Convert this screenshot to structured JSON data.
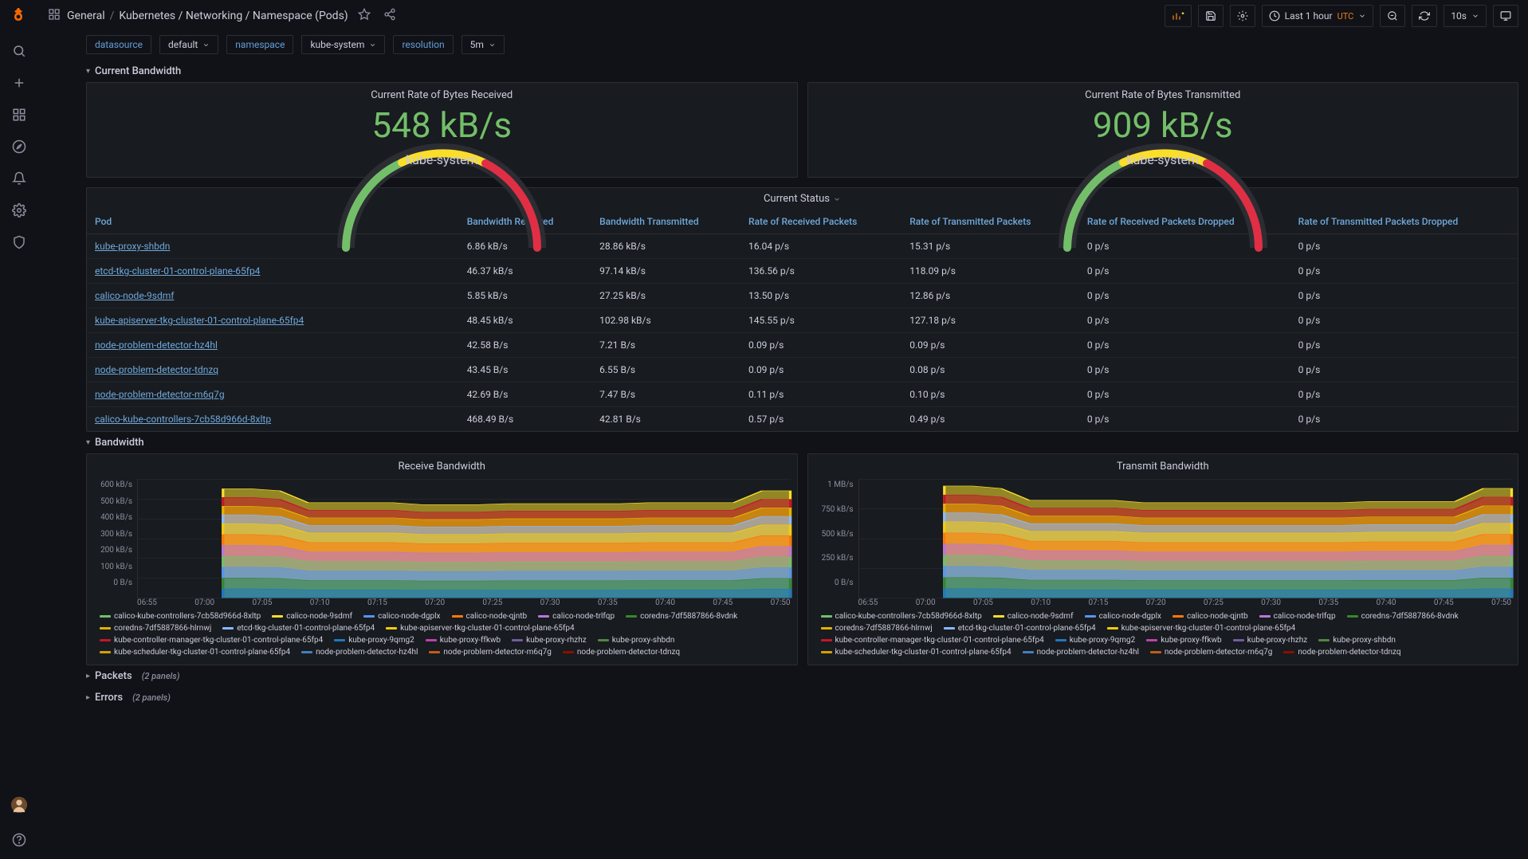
{
  "breadcrumb": {
    "root": "General",
    "path": "Kubernetes / Networking / Namespace (Pods)"
  },
  "timeRange": {
    "label": "Last 1 hour",
    "tz": "UTC",
    "refresh": "10s"
  },
  "filters": {
    "datasource_label": "datasource",
    "datasource_value": "default",
    "namespace_label": "namespace",
    "namespace_value": "kube-system",
    "resolution_label": "resolution",
    "resolution_value": "5m"
  },
  "rows": {
    "currentBandwidth": "Current Bandwidth",
    "bandwidth": "Bandwidth",
    "packets": "Packets",
    "packets_count": "(2 panels)",
    "errors": "Errors",
    "errors_count": "(2 panels)"
  },
  "gauges": {
    "rx": {
      "title": "Current Rate of Bytes Received",
      "value": "548 kB/s",
      "label": "kube-system"
    },
    "tx": {
      "title": "Current Rate of Bytes Transmitted",
      "value": "909 kB/s",
      "label": "kube-system"
    }
  },
  "statusTable": {
    "title": "Current Status",
    "headers": {
      "pod": "Pod",
      "bwRx": "Bandwidth Received",
      "bwTx": "Bandwidth Transmitted",
      "pktRx": "Rate of Received Packets",
      "pktTx": "Rate of Transmitted Packets",
      "dropRx": "Rate of Received Packets Dropped",
      "dropTx": "Rate of Transmitted Packets Dropped"
    },
    "rows": [
      {
        "pod": "kube-proxy-shbdn",
        "bwRx": "6.86 kB/s",
        "bwTx": "28.86 kB/s",
        "pktRx": "16.04 p/s",
        "pktTx": "15.31 p/s",
        "dropRx": "0 p/s",
        "dropTx": "0 p/s"
      },
      {
        "pod": "etcd-tkg-cluster-01-control-plane-65fp4",
        "bwRx": "46.37 kB/s",
        "bwTx": "97.14 kB/s",
        "pktRx": "136.56 p/s",
        "pktTx": "118.09 p/s",
        "dropRx": "0 p/s",
        "dropTx": "0 p/s"
      },
      {
        "pod": "calico-node-9sdmf",
        "bwRx": "5.85 kB/s",
        "bwTx": "27.25 kB/s",
        "pktRx": "13.50 p/s",
        "pktTx": "12.86 p/s",
        "dropRx": "0 p/s",
        "dropTx": "0 p/s"
      },
      {
        "pod": "kube-apiserver-tkg-cluster-01-control-plane-65fp4",
        "bwRx": "48.45 kB/s",
        "bwTx": "102.98 kB/s",
        "pktRx": "145.55 p/s",
        "pktTx": "127.18 p/s",
        "dropRx": "0 p/s",
        "dropTx": "0 p/s"
      },
      {
        "pod": "node-problem-detector-hz4hl",
        "bwRx": "42.58 B/s",
        "bwTx": "7.21 B/s",
        "pktRx": "0.09 p/s",
        "pktTx": "0.09 p/s",
        "dropRx": "0 p/s",
        "dropTx": "0 p/s"
      },
      {
        "pod": "node-problem-detector-tdnzq",
        "bwRx": "43.45 B/s",
        "bwTx": "6.55 B/s",
        "pktRx": "0.09 p/s",
        "pktTx": "0.08 p/s",
        "dropRx": "0 p/s",
        "dropTx": "0 p/s"
      },
      {
        "pod": "node-problem-detector-m6q7g",
        "bwRx": "42.69 B/s",
        "bwTx": "7.47 B/s",
        "pktRx": "0.11 p/s",
        "pktTx": "0.10 p/s",
        "dropRx": "0 p/s",
        "dropTx": "0 p/s"
      },
      {
        "pod": "calico-kube-controllers-7cb58d966d-8xltp",
        "bwRx": "468.49 B/s",
        "bwTx": "42.81 B/s",
        "pktRx": "0.57 p/s",
        "pktTx": "0.49 p/s",
        "dropRx": "0 p/s",
        "dropTx": "0 p/s"
      }
    ]
  },
  "chart_data": [
    {
      "id": "rxGraph",
      "type": "area",
      "title": "Receive Bandwidth",
      "ylabel": "",
      "y_ticks": [
        "600 kB/s",
        "500 kB/s",
        "400 kB/s",
        "300 kB/s",
        "200 kB/s",
        "100 kB/s",
        "0 B/s"
      ],
      "y_range": [
        0,
        600
      ],
      "x_ticks": [
        "06:55",
        "07:00",
        "07:05",
        "07:10",
        "07:15",
        "07:20",
        "07:25",
        "07:30",
        "07:35",
        "07:40",
        "07:45",
        "07:50"
      ],
      "stack_top_kb_s": [
        null,
        null,
        null,
        550,
        550,
        540,
        480,
        480,
        480,
        480,
        470,
        470,
        470,
        475,
        475,
        475,
        475,
        475,
        480,
        480,
        480,
        480,
        540,
        540
      ],
      "legend": [
        {
          "name": "calico-kube-controllers-7cb58d966d-8xltp",
          "color": "#73bf69"
        },
        {
          "name": "calico-node-9sdmf",
          "color": "#fade2a"
        },
        {
          "name": "calico-node-dgplx",
          "color": "#5794f2"
        },
        {
          "name": "calico-node-qjntb",
          "color": "#ff780a"
        },
        {
          "name": "calico-node-trlfqp",
          "color": "#b877d9"
        },
        {
          "name": "coredns-7df5887866-8vdnk",
          "color": "#37872d"
        },
        {
          "name": "coredns-7df5887866-hlrnwj",
          "color": "#e0b400"
        },
        {
          "name": "etcd-tkg-cluster-01-control-plane-65fp4",
          "color": "#8ab8ff"
        },
        {
          "name": "kube-apiserver-tkg-cluster-01-control-plane-65fp4",
          "color": "#f2cc0c"
        },
        {
          "name": "kube-controller-manager-tkg-cluster-01-control-plane-65fp4",
          "color": "#c4162a"
        },
        {
          "name": "kube-proxy-9qmg2",
          "color": "#1f78c1"
        },
        {
          "name": "kube-proxy-ffkwb",
          "color": "#ba43a9"
        },
        {
          "name": "kube-proxy-rhzhz",
          "color": "#705da0"
        },
        {
          "name": "kube-proxy-shbdn",
          "color": "#508642"
        },
        {
          "name": "kube-scheduler-tkg-cluster-01-control-plane-65fp4",
          "color": "#cca300"
        },
        {
          "name": "node-problem-detector-hz4hl",
          "color": "#447ebc"
        },
        {
          "name": "node-problem-detector-m6q7g",
          "color": "#c15c17"
        },
        {
          "name": "node-problem-detector-tdnzq",
          "color": "#890f02"
        }
      ]
    },
    {
      "id": "txGraph",
      "type": "area",
      "title": "Transmit Bandwidth",
      "ylabel": "",
      "y_ticks": [
        "1 MB/s",
        "750 kB/s",
        "500 kB/s",
        "250 kB/s",
        "0 B/s"
      ],
      "y_range": [
        0,
        1000
      ],
      "x_ticks": [
        "06:55",
        "07:00",
        "07:05",
        "07:10",
        "07:15",
        "07:20",
        "07:25",
        "07:30",
        "07:35",
        "07:40",
        "07:45",
        "07:50"
      ],
      "stack_top_kb_s": [
        null,
        null,
        null,
        940,
        940,
        920,
        820,
        820,
        820,
        820,
        800,
        800,
        800,
        800,
        800,
        800,
        800,
        800,
        810,
        810,
        810,
        810,
        920,
        920
      ],
      "legend": [
        {
          "name": "calico-kube-controllers-7cb58d966d-8xltp",
          "color": "#73bf69"
        },
        {
          "name": "calico-node-9sdmf",
          "color": "#fade2a"
        },
        {
          "name": "calico-node-dgplx",
          "color": "#5794f2"
        },
        {
          "name": "calico-node-qjntb",
          "color": "#ff780a"
        },
        {
          "name": "calico-node-trlfqp",
          "color": "#b877d9"
        },
        {
          "name": "coredns-7df5887866-8vdnk",
          "color": "#37872d"
        },
        {
          "name": "coredns-7df5887866-hlrnwj",
          "color": "#e0b400"
        },
        {
          "name": "etcd-tkg-cluster-01-control-plane-65fp4",
          "color": "#8ab8ff"
        },
        {
          "name": "kube-apiserver-tkg-cluster-01-control-plane-65fp4",
          "color": "#f2cc0c"
        },
        {
          "name": "kube-controller-manager-tkg-cluster-01-control-plane-65fp4",
          "color": "#c4162a"
        },
        {
          "name": "kube-proxy-9qmg2",
          "color": "#1f78c1"
        },
        {
          "name": "kube-proxy-ffkwb",
          "color": "#ba43a9"
        },
        {
          "name": "kube-proxy-rhzhz",
          "color": "#705da0"
        },
        {
          "name": "kube-proxy-shbdn",
          "color": "#508642"
        },
        {
          "name": "kube-scheduler-tkg-cluster-01-control-plane-65fp4",
          "color": "#cca300"
        },
        {
          "name": "node-problem-detector-hz4hl",
          "color": "#447ebc"
        },
        {
          "name": "node-problem-detector-m6q7g",
          "color": "#c15c17"
        },
        {
          "name": "node-problem-detector-tdnzq",
          "color": "#890f02"
        }
      ]
    }
  ]
}
